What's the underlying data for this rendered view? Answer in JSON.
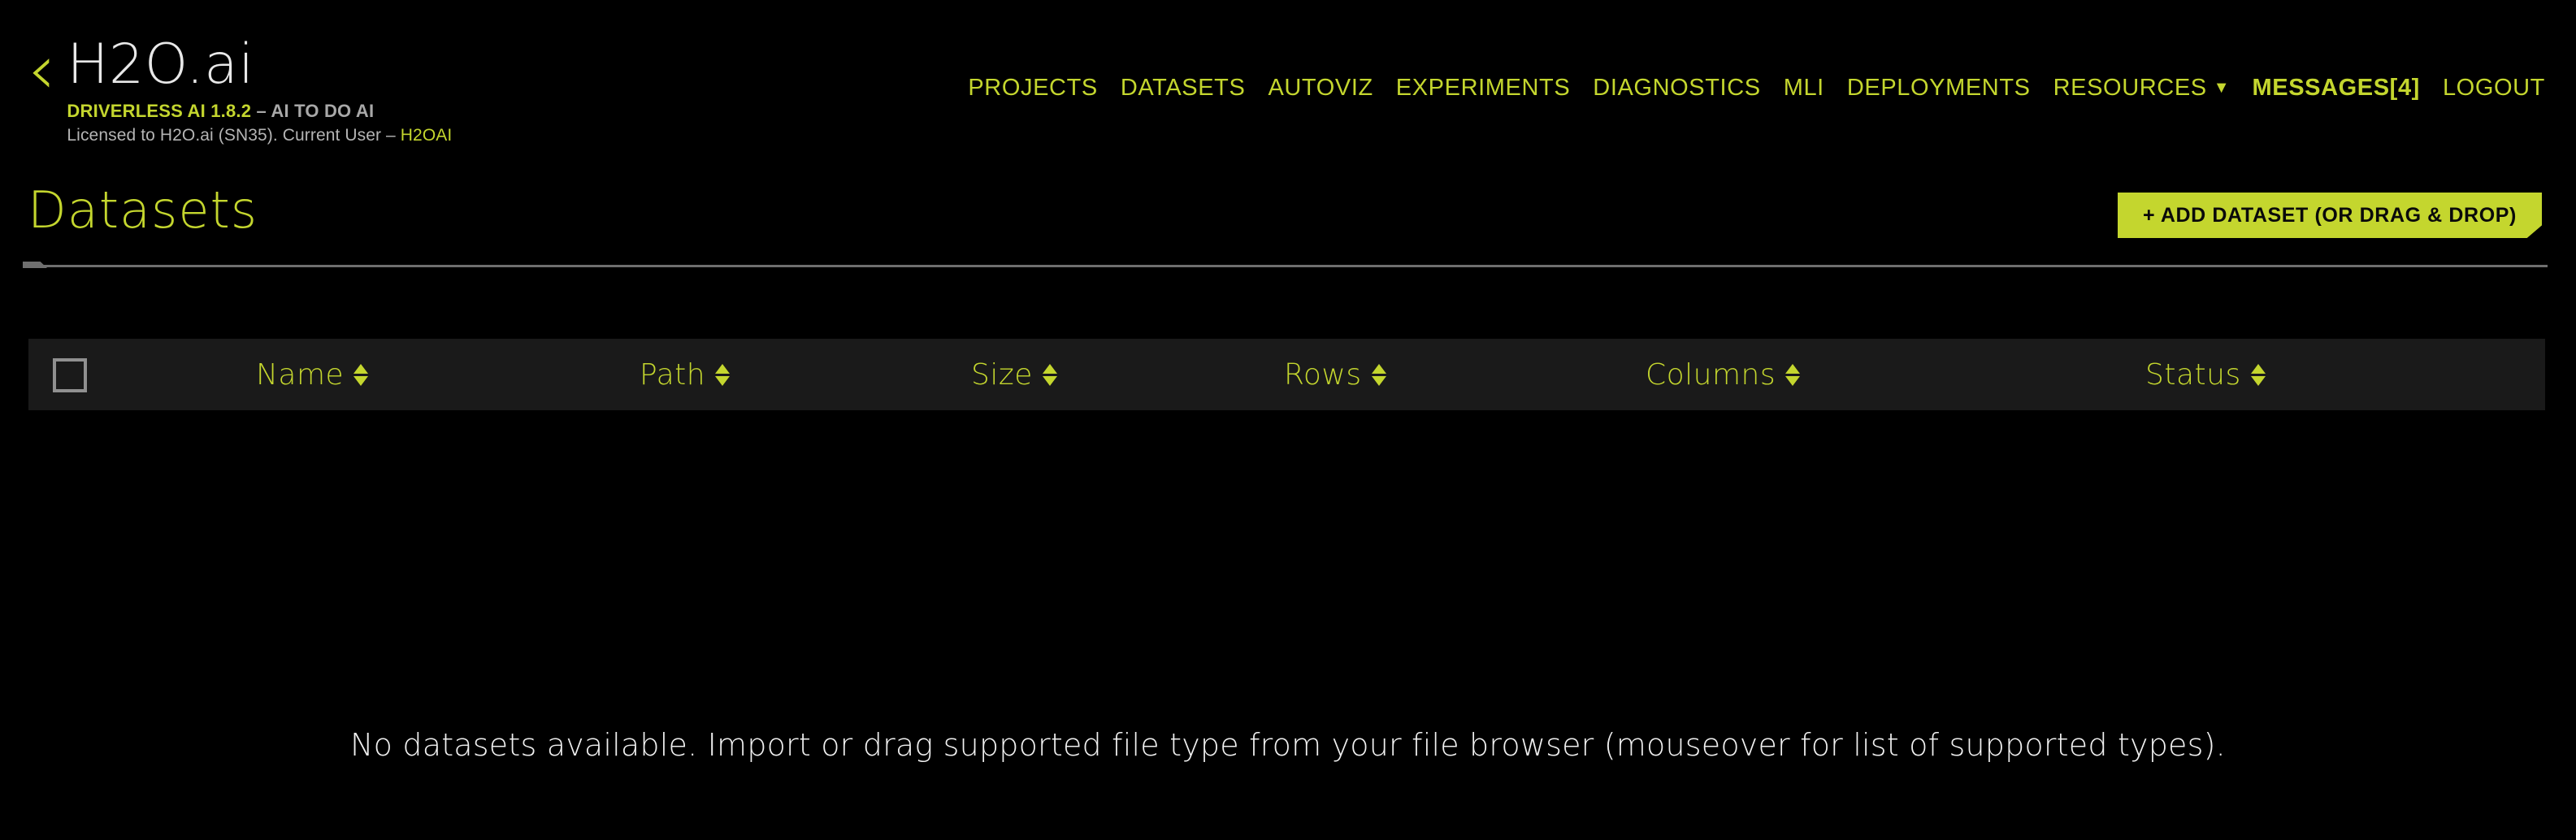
{
  "colors": {
    "accent": "#c4d62e",
    "background": "#000000",
    "table_header_bg": "#1a1a1a",
    "muted_text": "#b4b4b4",
    "primary_text": "#e8e8e8",
    "divider": "#6f6f6f"
  },
  "header": {
    "back_icon": "‹",
    "brand_title": "H2O.ai",
    "product_line_accent": "DRIVERLESS AI 1.8.2",
    "product_line_muted": " – AI TO DO AI",
    "license_prefix": "Licensed to H2O.ai (SN35). Current User – ",
    "license_user": "H2OAI"
  },
  "nav": {
    "items": [
      {
        "label": "PROJECTS",
        "bold": false,
        "caret": false
      },
      {
        "label": "DATASETS",
        "bold": false,
        "caret": false
      },
      {
        "label": "AUTOVIZ",
        "bold": false,
        "caret": false
      },
      {
        "label": "EXPERIMENTS",
        "bold": false,
        "caret": false
      },
      {
        "label": "DIAGNOSTICS",
        "bold": false,
        "caret": false
      },
      {
        "label": "MLI",
        "bold": false,
        "caret": false
      },
      {
        "label": "DEPLOYMENTS",
        "bold": false,
        "caret": false
      },
      {
        "label": "RESOURCES",
        "bold": false,
        "caret": true
      },
      {
        "label": "MESSAGES[4]",
        "bold": true,
        "caret": false
      },
      {
        "label": "LOGOUT",
        "bold": false,
        "caret": false
      }
    ],
    "caret_glyph": "▼"
  },
  "page": {
    "title": "Datasets",
    "add_dataset_label": "+ ADD DATASET (OR DRAG & DROP)"
  },
  "table": {
    "select_all_checked": false,
    "columns": [
      {
        "label": "Name",
        "sortable": true
      },
      {
        "label": "Path",
        "sortable": true
      },
      {
        "label": "Size",
        "sortable": true
      },
      {
        "label": "Rows",
        "sortable": true
      },
      {
        "label": "Columns",
        "sortable": true
      },
      {
        "label": "Status",
        "sortable": true
      }
    ],
    "rows": [],
    "empty_message": "No datasets available. Import or drag supported file type from your file browser (mouseover for list of supported types)."
  }
}
